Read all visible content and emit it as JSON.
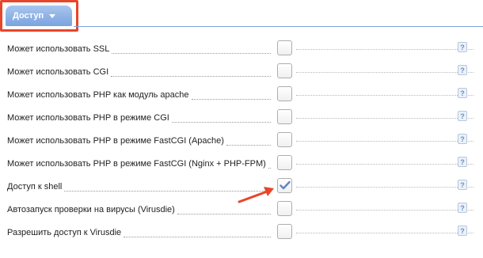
{
  "tab": {
    "label": "Доступ",
    "icon": "caret-down-icon"
  },
  "help_label": "?",
  "rows": [
    {
      "label": "Может использовать SSL",
      "checked": false
    },
    {
      "label": "Может использовать CGI",
      "checked": false
    },
    {
      "label": "Может использовать PHP как модуль apache",
      "checked": false
    },
    {
      "label": "Может использовать PHP в режиме CGI",
      "checked": false
    },
    {
      "label": "Может использовать PHP в режиме FastCGI (Apache)",
      "checked": false
    },
    {
      "label": "Может использовать PHP в режиме FastCGI (Nginx + PHP-FPM)",
      "checked": false
    },
    {
      "label": "Доступ к shell",
      "checked": true
    },
    {
      "label": "Автозапуск проверки на вирусы (Virusdie)",
      "checked": false
    },
    {
      "label": "Разрешить доступ к Virusdie",
      "checked": false
    }
  ],
  "colors": {
    "accent": "#7aa3df",
    "highlight": "#e8452b",
    "check": "#5f86c4"
  }
}
